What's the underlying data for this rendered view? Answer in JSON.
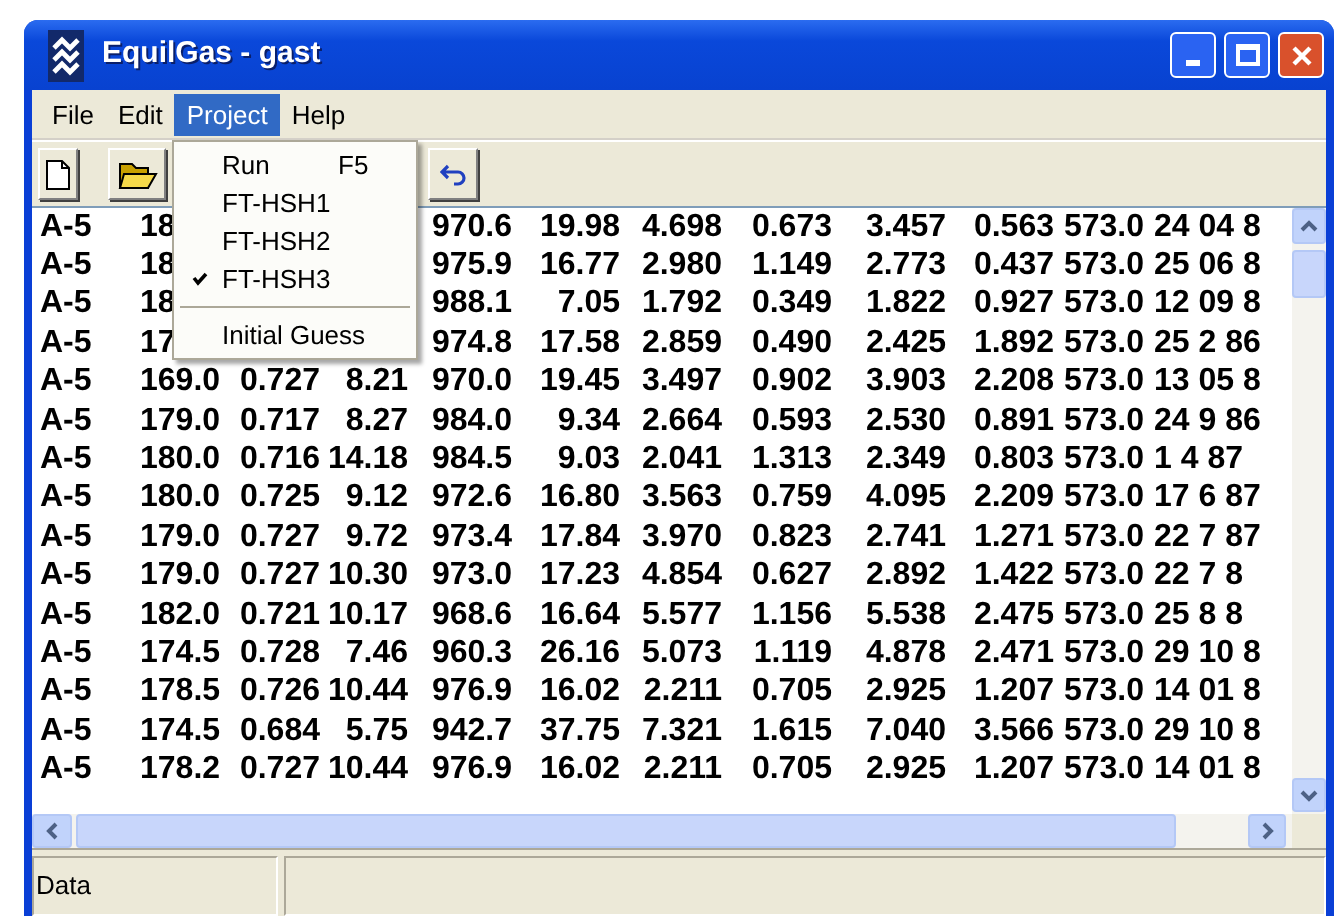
{
  "window": {
    "title": "EquilGas - gast"
  },
  "menu_bar": [
    {
      "label": "File",
      "selected": false
    },
    {
      "label": "Edit",
      "selected": false
    },
    {
      "label": "Project",
      "selected": true
    },
    {
      "label": "Help",
      "selected": false
    }
  ],
  "open_menu": {
    "items": [
      {
        "kind": "item",
        "label": "Run",
        "shortcut": "F5",
        "checked": false
      },
      {
        "kind": "item",
        "label": "FT-HSH1",
        "checked": false
      },
      {
        "kind": "item",
        "label": "FT-HSH2",
        "checked": false
      },
      {
        "kind": "item",
        "label": "FT-HSH3",
        "checked": true
      },
      {
        "kind": "separator"
      },
      {
        "kind": "item",
        "label": "Initial Guess",
        "checked": false
      }
    ]
  },
  "data_rows": [
    {
      "cells": [
        "A-5",
        "18",
        "970.6",
        "19.98",
        "4.698",
        "0.673",
        "3.457",
        "0.563",
        "573.0",
        "24 04 8"
      ]
    },
    {
      "cells": [
        "A-5",
        "18",
        "975.9",
        "16.77",
        "2.980",
        "1.149",
        "2.773",
        "0.437",
        "573.0",
        "25 06 8"
      ]
    },
    {
      "cells": [
        "A-5",
        "18",
        "988.1",
        "7.05",
        "1.792",
        "0.349",
        "1.822",
        "0.927",
        "573.0",
        "12 09 8"
      ]
    },
    {
      "cells": [
        "A-5",
        "17",
        "974.8",
        "17.58",
        "2.859",
        "0.490",
        "2.425",
        "1.892",
        "573.0",
        "25 2 86"
      ]
    },
    {
      "cells": [
        "A-5",
        "169.0",
        "0.727",
        "8.21",
        "970.0",
        "19.45",
        "3.497",
        "0.902",
        "3.903",
        "2.208",
        "573.0",
        "13 05 8"
      ]
    },
    {
      "cells": [
        "A-5",
        "179.0",
        "0.717",
        "8.27",
        "984.0",
        "9.34",
        "2.664",
        "0.593",
        "2.530",
        "0.891",
        "573.0",
        "24 9 86"
      ]
    },
    {
      "cells": [
        "A-5",
        "180.0",
        "0.716",
        "14.18",
        "984.5",
        "9.03",
        "2.041",
        "1.313",
        "2.349",
        "0.803",
        "573.0",
        "1 4 87"
      ]
    },
    {
      "cells": [
        "A-5",
        "180.0",
        "0.725",
        "9.12",
        "972.6",
        "16.80",
        "3.563",
        "0.759",
        "4.095",
        "2.209",
        "573.0",
        "17 6 87"
      ]
    },
    {
      "cells": [
        "A-5",
        "179.0",
        "0.727",
        "9.72",
        "973.4",
        "17.84",
        "3.970",
        "0.823",
        "2.741",
        "1.271",
        "573.0",
        "22 7 87"
      ]
    },
    {
      "cells": [
        "A-5",
        "179.0",
        "0.727",
        "10.30",
        "973.0",
        "17.23",
        "4.854",
        "0.627",
        "2.892",
        "1.422",
        "573.0",
        "22 7 8"
      ]
    },
    {
      "cells": [
        "A-5",
        "182.0",
        "0.721",
        "10.17",
        "968.6",
        "16.64",
        "5.577",
        "1.156",
        "5.538",
        "2.475",
        "573.0",
        "25 8 8"
      ]
    },
    {
      "cells": [
        "A-5",
        "174.5",
        "0.728",
        "7.46",
        "960.3",
        "26.16",
        "5.073",
        "1.119",
        "4.878",
        "2.471",
        "573.0",
        "29 10 8"
      ]
    },
    {
      "cells": [
        "A-5",
        "178.5",
        "0.726",
        "10.44",
        "976.9",
        "16.02",
        "2.211",
        "0.705",
        "2.925",
        "1.207",
        "573.0",
        "14 01 8"
      ]
    },
    {
      "cells": [
        "A-5",
        "174.5",
        "0.684",
        "5.75",
        "942.7",
        "37.75",
        "7.321",
        "1.615",
        "7.040",
        "3.566",
        "573.0",
        "29 10 8"
      ]
    },
    {
      "cells": [
        "A-5",
        "178.2",
        "0.727",
        "10.44",
        "976.9",
        "16.02",
        "2.211",
        "0.705",
        "2.925",
        "1.207",
        "573.0",
        "14 01 8"
      ]
    }
  ],
  "status_bar": {
    "panels": [
      "Data"
    ]
  }
}
